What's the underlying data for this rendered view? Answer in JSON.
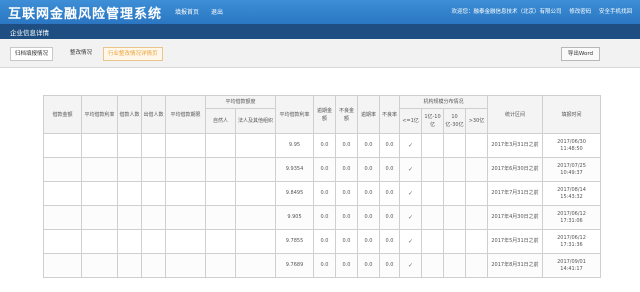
{
  "header": {
    "title": "互联网金融风险管理系统",
    "nav": [
      "填报首页",
      "退出"
    ],
    "welcome": "欢迎您：",
    "company": "融泰金融信息技术（北京）有限公司",
    "change_password": "修改密码",
    "security_question": "安全手机找回"
  },
  "section": {
    "title": "企业信息详情"
  },
  "tabs": [
    {
      "label": "归档填报情况"
    },
    {
      "label": "整改情况"
    },
    {
      "label": "行业整改情况详情页"
    }
  ],
  "toolbar": {
    "export_label": "导出Word"
  },
  "table": {
    "headers": {
      "loan_amount": "借款金额",
      "borrowers_count": "平均借款利率",
      "lenders": "借款人数",
      "investors": "出借人数",
      "avg_term": "平均借款期限",
      "avg_loan_amount": "平均借款额度",
      "natural_person": "自然人",
      "legal_person": "法人及其他组织",
      "avg_rate": "平均借款利率",
      "overdue_amount": "逾期金额",
      "bad_amount": "不良金额",
      "overdue_rate": "逾期率",
      "bad_rate": "不良率",
      "term_distribution": "机构规模分布情况",
      "term_lt1": "<=1亿",
      "term_1_10": "1亿-10亿",
      "term_10_30": "10亿-30亿",
      "term_gt30": ">30亿",
      "stat_deadline": "统计区间",
      "submit_time": "填报时间"
    },
    "rows": [
      {
        "rate": "9.95",
        "overdue": "0.0",
        "bad": "0.0",
        "overdue_rate": "0.0",
        "bad_rate": "0.0",
        "check": "✓",
        "deadline": "2017年3月31日之前",
        "submit_date": "2017/06/30",
        "submit_clock": "11:48:50"
      },
      {
        "rate": "9.9354",
        "overdue": "0.0",
        "bad": "0.0",
        "overdue_rate": "0.0",
        "bad_rate": "0.0",
        "check": "✓",
        "deadline": "2017年6月30日之前",
        "submit_date": "2017/07/25",
        "submit_clock": "10:49:37"
      },
      {
        "rate": "9.8495",
        "overdue": "0.0",
        "bad": "0.0",
        "overdue_rate": "0.0",
        "bad_rate": "0.0",
        "check": "✓",
        "deadline": "2017年7月31日之前",
        "submit_date": "2017/08/14",
        "submit_clock": "15:43:32"
      },
      {
        "rate": "9.905",
        "overdue": "0.0",
        "bad": "0.0",
        "overdue_rate": "0.0",
        "bad_rate": "0.0",
        "check": "✓",
        "deadline": "2017年4月30日之前",
        "submit_date": "2017/06/12",
        "submit_clock": "17:31:06"
      },
      {
        "rate": "9.7855",
        "overdue": "0.0",
        "bad": "0.0",
        "overdue_rate": "0.0",
        "bad_rate": "0.0",
        "check": "✓",
        "deadline": "2017年5月31日之前",
        "submit_date": "2017/06/12",
        "submit_clock": "17:31:36"
      },
      {
        "rate": "9.7689",
        "overdue": "0.0",
        "bad": "0.0",
        "overdue_rate": "0.0",
        "bad_rate": "0.0",
        "check": "✓",
        "deadline": "2017年8月31日之前",
        "submit_date": "2017/09/01",
        "submit_clock": "14:41:17"
      }
    ]
  }
}
